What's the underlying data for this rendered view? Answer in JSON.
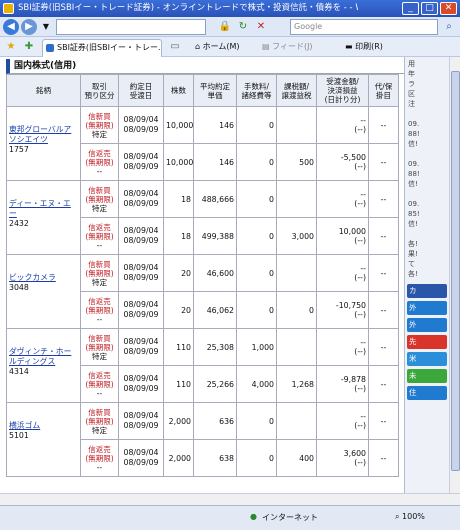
{
  "window": {
    "title": "SBI証券(旧SBIイー・トレード証券) - オンライントレードで株式・投資信託・債券を - - Wind..."
  },
  "browser": {
    "address": "",
    "search_placeholder": "Google",
    "tab_label": "SBI証券(旧SBIイー・トレー...",
    "home": "ホーム(M)",
    "feed": "フィード(J)",
    "print": "印刷(R)"
  },
  "page": {
    "section_title": "国内株式(信用)",
    "headers": [
      "銘柄",
      "取引\n預り区分",
      "約定日\n受渡日",
      "株数",
      "平均約定\n単価",
      "手数料/\n諸経費等",
      "課税額/\n譲渡益税",
      "受渡金額/\n決済損益\n(日計り分)",
      "代/保\n掛目"
    ],
    "stocks": [
      {
        "name": "東邦グローバルアソシエイツ",
        "code": "1757",
        "rows": [
          {
            "trade": "信新買",
            "trade2": "(無期限)",
            "trade3": "特定",
            "date1": "08/09/04",
            "date2": "08/09/09",
            "qty": "10,000",
            "price": "146",
            "fee": "0",
            "tax": "",
            "amount": "--",
            "pl": "(--)",
            "margin": "--"
          },
          {
            "trade": "信返売",
            "trade2": "(無期限)",
            "trade3": "--",
            "date1": "08/09/04",
            "date2": "08/09/09",
            "qty": "10,000",
            "price": "146",
            "fee": "0",
            "tax": "500",
            "amount": "-5,500",
            "pl": "(--)",
            "margin": "--"
          }
        ]
      },
      {
        "name": "ディー・エヌ・エー",
        "code": "2432",
        "rows": [
          {
            "trade": "信新買",
            "trade2": "(無期限)",
            "trade3": "特定",
            "date1": "08/09/04",
            "date2": "08/09/09",
            "qty": "18",
            "price": "488,666",
            "fee": "0",
            "tax": "",
            "amount": "--",
            "pl": "(--)",
            "margin": "--"
          },
          {
            "trade": "信返売",
            "trade2": "(無期限)",
            "trade3": "--",
            "date1": "08/09/04",
            "date2": "08/09/09",
            "qty": "18",
            "price": "499,388",
            "fee": "0",
            "tax": "3,000",
            "amount": "10,000",
            "pl": "(--)",
            "margin": "--"
          }
        ]
      },
      {
        "name": "ビックカメラ",
        "code": "3048",
        "rows": [
          {
            "trade": "信新買",
            "trade2": "(無期限)",
            "trade3": "特定",
            "date1": "08/09/04",
            "date2": "08/09/09",
            "qty": "20",
            "price": "46,600",
            "fee": "0",
            "tax": "",
            "amount": "--",
            "pl": "(--)",
            "margin": "--"
          },
          {
            "trade": "信返売",
            "trade2": "(無期限)",
            "trade3": "--",
            "date1": "08/09/04",
            "date2": "08/09/09",
            "qty": "20",
            "price": "46,062",
            "fee": "0",
            "tax": "0",
            "amount": "-10,750",
            "pl": "(--)",
            "margin": "--"
          }
        ]
      },
      {
        "name": "ダヴィンチ・ホールディングス",
        "code": "4314",
        "rows": [
          {
            "trade": "信新買",
            "trade2": "(無期限)",
            "trade3": "特定",
            "date1": "08/09/04",
            "date2": "08/09/09",
            "qty": "110",
            "price": "25,308",
            "fee": "1,000",
            "tax": "",
            "amount": "--",
            "pl": "(--)",
            "margin": "--"
          },
          {
            "trade": "信返売",
            "trade2": "(無期限)",
            "trade3": "--",
            "date1": "08/09/04",
            "date2": "08/09/09",
            "qty": "110",
            "price": "25,266",
            "fee": "4,000",
            "tax": "1,268",
            "amount": "-9,878",
            "pl": "(--)",
            "margin": "--"
          }
        ]
      },
      {
        "name": "横浜ゴム",
        "code": "5101",
        "rows": [
          {
            "trade": "信新買",
            "trade2": "(無期限)",
            "trade3": "特定",
            "date1": "08/09/04",
            "date2": "08/09/09",
            "qty": "2,000",
            "price": "636",
            "fee": "0",
            "tax": "",
            "amount": "--",
            "pl": "(--)",
            "margin": "--"
          },
          {
            "trade": "信返売",
            "trade2": "(無期限)",
            "trade3": "--",
            "date1": "08/09/04",
            "date2": "08/09/09",
            "qty": "2,000",
            "price": "638",
            "fee": "0",
            "tax": "400",
            "amount": "3,600",
            "pl": "(--)",
            "margin": "--"
          }
        ]
      }
    ]
  },
  "sidebar": {
    "text": "用\n年\nラ\n区\n注\n\n09.\n88!\n信!\n\n09.\n88!\n信!\n\n09.\n85!\n信!\n\n各!\n果!\nて\n各!",
    "buttons": [
      {
        "label": "カ",
        "color": "#2a55a8"
      },
      {
        "label": "外",
        "color": "#1f7ad0"
      },
      {
        "label": "外",
        "color": "#1f7ad0"
      },
      {
        "label": "先",
        "color": "#d8342a"
      },
      {
        "label": "米",
        "color": "#2a8fd8"
      },
      {
        "label": "未",
        "color": "#3ca83c"
      },
      {
        "label": "住",
        "color": "#1f7ad0"
      }
    ]
  },
  "status": {
    "zone": "インターネット",
    "zoom": "100%"
  }
}
